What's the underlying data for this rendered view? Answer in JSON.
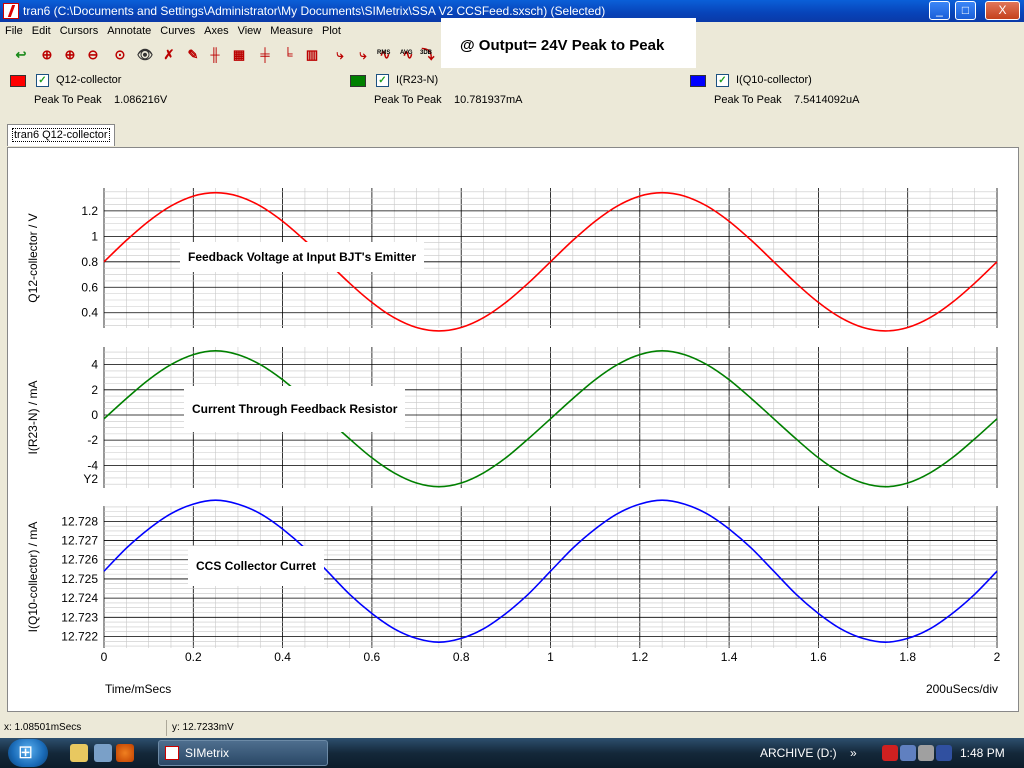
{
  "window": {
    "title": "tran6 (C:\\Documents and Settings\\Administrator\\My Documents\\SIMetrix\\SSA V2 CCSFeed.sxsch) (Selected)",
    "minimize": "_",
    "maximize": "□",
    "close": "X"
  },
  "menu": [
    "File",
    "Edit",
    "Cursors",
    "Annotate",
    "Curves",
    "Axes",
    "View",
    "Measure",
    "Plot"
  ],
  "toolbar_icons": [
    {
      "name": "undo-icon",
      "glyph": "↩",
      "color": "#1a8a1a"
    },
    {
      "name": "zoom-full-icon",
      "glyph": "⊕",
      "color": "#b00"
    },
    {
      "name": "zoom-in-icon",
      "glyph": "⊕",
      "color": "#b00"
    },
    {
      "name": "zoom-out-icon",
      "glyph": "⊖",
      "color": "#b00"
    },
    {
      "name": "zoom-box-icon",
      "glyph": "⊙",
      "color": "#b00"
    },
    {
      "name": "view-icon",
      "glyph": "👁",
      "color": "#333"
    },
    {
      "name": "delete-curve-icon",
      "glyph": "✗",
      "color": "#b00"
    },
    {
      "name": "abc-label-icon",
      "glyph": "✎",
      "color": "#b00"
    },
    {
      "name": "add-cursor-icon",
      "glyph": "╫",
      "color": "#b00"
    },
    {
      "name": "cursor-settings-icon",
      "glyph": "▦",
      "color": "#b00"
    },
    {
      "name": "grid-icon",
      "glyph": "╪",
      "color": "#b00"
    },
    {
      "name": "axis-icon",
      "glyph": "╘",
      "color": "#b00"
    },
    {
      "name": "new-grid-icon",
      "glyph": "▥",
      "color": "#b00"
    },
    {
      "name": "rise-time-icon",
      "glyph": "⤷",
      "color": "#b00"
    },
    {
      "name": "fall-time-icon",
      "glyph": "⤷",
      "color": "#b00"
    },
    {
      "name": "rms-icon",
      "glyph": "∿",
      "color": "#b00",
      "label": "RMS"
    },
    {
      "name": "avg-icon",
      "glyph": "∿",
      "color": "#b00",
      "label": "AVG"
    },
    {
      "name": "3db-low-icon",
      "glyph": "⤵",
      "color": "#b00",
      "label": "3DB"
    },
    {
      "name": "3db-high-icon",
      "glyph": "⤴",
      "color": "#b00",
      "label": "3DB"
    }
  ],
  "overlay_note": "@ Output= 24V Peak to Peak",
  "legend": [
    {
      "name": "Q12-collector",
      "color": "#ff0000",
      "checked": "✓",
      "measure_label": "Peak To Peak",
      "measure_value": "1.086216V"
    },
    {
      "name": "I(R23-N)",
      "color": "#008000",
      "checked": "✓",
      "measure_label": "Peak To Peak",
      "measure_value": "10.781937mA"
    },
    {
      "name": "I(Q10-collector)",
      "color": "#0000ff",
      "checked": "✓",
      "measure_label": "Peak To Peak",
      "measure_value": "7.5414092uA"
    }
  ],
  "tab": "tran6 Q12-collector",
  "annotations": {
    "top": "Feedback Voltage at Input BJT's Emitter",
    "mid": "Current Through Feedback Resistor",
    "bot": "CCS Collector Curret"
  },
  "chart_data": {
    "type": "line",
    "xlabel": "Time/mSecs",
    "xscale_label": "200uSecs/div",
    "xlim": [
      0,
      2
    ],
    "xticks": [
      "0",
      "0.2",
      "0.4",
      "0.6",
      "0.8",
      "1",
      "1.2",
      "1.4",
      "1.6",
      "1.8",
      "2"
    ],
    "grid": true,
    "panels": [
      {
        "ylabel": "Q12-collector / V",
        "ylim": [
          0.28,
          1.38
        ],
        "yticks": [
          "0.4",
          "0.6",
          "0.8",
          "1",
          "1.2"
        ],
        "series": [
          {
            "name": "Q12-collector",
            "color": "#ff0000",
            "x": [
              0,
              0.05,
              0.1,
              0.15,
              0.2,
              0.25,
              0.3,
              0.35,
              0.4,
              0.45,
              0.5,
              0.55,
              0.6,
              0.65,
              0.7,
              0.75,
              0.8,
              0.85,
              0.9,
              0.95,
              1,
              1.05,
              1.1,
              1.15,
              1.2,
              1.25,
              1.3,
              1.35,
              1.4,
              1.45,
              1.5,
              1.55,
              1.6,
              1.65,
              1.7,
              1.75,
              1.8,
              1.85,
              1.9,
              1.95,
              2
            ],
            "y": [
              0.8,
              0.968,
              1.119,
              1.239,
              1.316,
              1.343,
              1.316,
              1.239,
              1.119,
              0.968,
              0.8,
              0.632,
              0.481,
              0.361,
              0.284,
              0.257,
              0.284,
              0.361,
              0.481,
              0.632,
              0.8,
              0.968,
              1.119,
              1.239,
              1.316,
              1.343,
              1.316,
              1.239,
              1.119,
              0.968,
              0.8,
              0.632,
              0.481,
              0.361,
              0.284,
              0.257,
              0.284,
              0.361,
              0.481,
              0.632,
              0.8
            ]
          }
        ]
      },
      {
        "ylabel": "I(R23-N) / mA",
        "ylim": [
          -5.8,
          5.4
        ],
        "yticks": [
          "4",
          "2",
          "0",
          "-2",
          "-4"
        ],
        "ytick_values": [
          4,
          2,
          0,
          -2,
          -4
        ],
        "extra_tick": "Y2",
        "series": [
          {
            "name": "I(R23-N)",
            "color": "#008000",
            "x": [
              0,
              0.05,
              0.1,
              0.15,
              0.2,
              0.25,
              0.3,
              0.35,
              0.4,
              0.45,
              0.5,
              0.55,
              0.6,
              0.65,
              0.7,
              0.75,
              0.8,
              0.85,
              0.9,
              0.95,
              1,
              1.05,
              1.1,
              1.15,
              1.2,
              1.25,
              1.3,
              1.35,
              1.4,
              1.45,
              1.5,
              1.55,
              1.6,
              1.65,
              1.7,
              1.75,
              1.8,
              1.85,
              1.9,
              1.95,
              2
            ],
            "y": [
              -0.3,
              1.3,
              2.8,
              4.0,
              4.8,
              5.1,
              4.8,
              4.0,
              2.8,
              1.3,
              -0.3,
              -1.9,
              -3.4,
              -4.6,
              -5.4,
              -5.7,
              -5.4,
              -4.6,
              -3.4,
              -1.9,
              -0.3,
              1.3,
              2.8,
              4.0,
              4.8,
              5.1,
              4.8,
              4.0,
              2.8,
              1.3,
              -0.3,
              -1.9,
              -3.4,
              -4.6,
              -5.4,
              -5.7,
              -5.4,
              -4.6,
              -3.4,
              -1.9,
              -0.3
            ]
          }
        ]
      },
      {
        "ylabel": "I(Q10-collector) / mA",
        "ylim": [
          12.7214,
          12.7288
        ],
        "yticks": [
          "12.728",
          "12.727",
          "12.726",
          "12.725",
          "12.724",
          "12.723",
          "12.722"
        ],
        "ytick_values": [
          12.728,
          12.727,
          12.726,
          12.725,
          12.724,
          12.723,
          12.722
        ],
        "series": [
          {
            "name": "I(Q10-collector)",
            "color": "#0000ff",
            "x": [
              0,
              0.05,
              0.1,
              0.15,
              0.2,
              0.25,
              0.3,
              0.35,
              0.4,
              0.45,
              0.5,
              0.55,
              0.6,
              0.65,
              0.7,
              0.75,
              0.8,
              0.85,
              0.9,
              0.95,
              1,
              1.05,
              1.1,
              1.15,
              1.2,
              1.25,
              1.3,
              1.35,
              1.4,
              1.45,
              1.5,
              1.55,
              1.6,
              1.65,
              1.7,
              1.75,
              1.8,
              1.85,
              1.9,
              1.95,
              2
            ],
            "y": [
              12.7254,
              12.7266,
              12.7276,
              12.7284,
              12.7289,
              12.7291,
              12.7289,
              12.7284,
              12.7276,
              12.7266,
              12.7254,
              12.7242,
              12.7232,
              12.7224,
              12.7219,
              12.7217,
              12.7219,
              12.7224,
              12.7232,
              12.7242,
              12.7254,
              12.7266,
              12.7276,
              12.7284,
              12.7289,
              12.7291,
              12.7289,
              12.7284,
              12.7276,
              12.7266,
              12.7254,
              12.7242,
              12.7232,
              12.7224,
              12.7219,
              12.7217,
              12.7219,
              12.7224,
              12.7232,
              12.7242,
              12.7254
            ]
          }
        ]
      }
    ]
  },
  "status": {
    "x": "x: 1.08501mSecs",
    "y": "y: 12.7233mV"
  },
  "taskbar": {
    "task_label": "SIMetrix",
    "drive": "ARCHIVE (D:)",
    "chevron": "»",
    "clock": "1:48 PM"
  }
}
